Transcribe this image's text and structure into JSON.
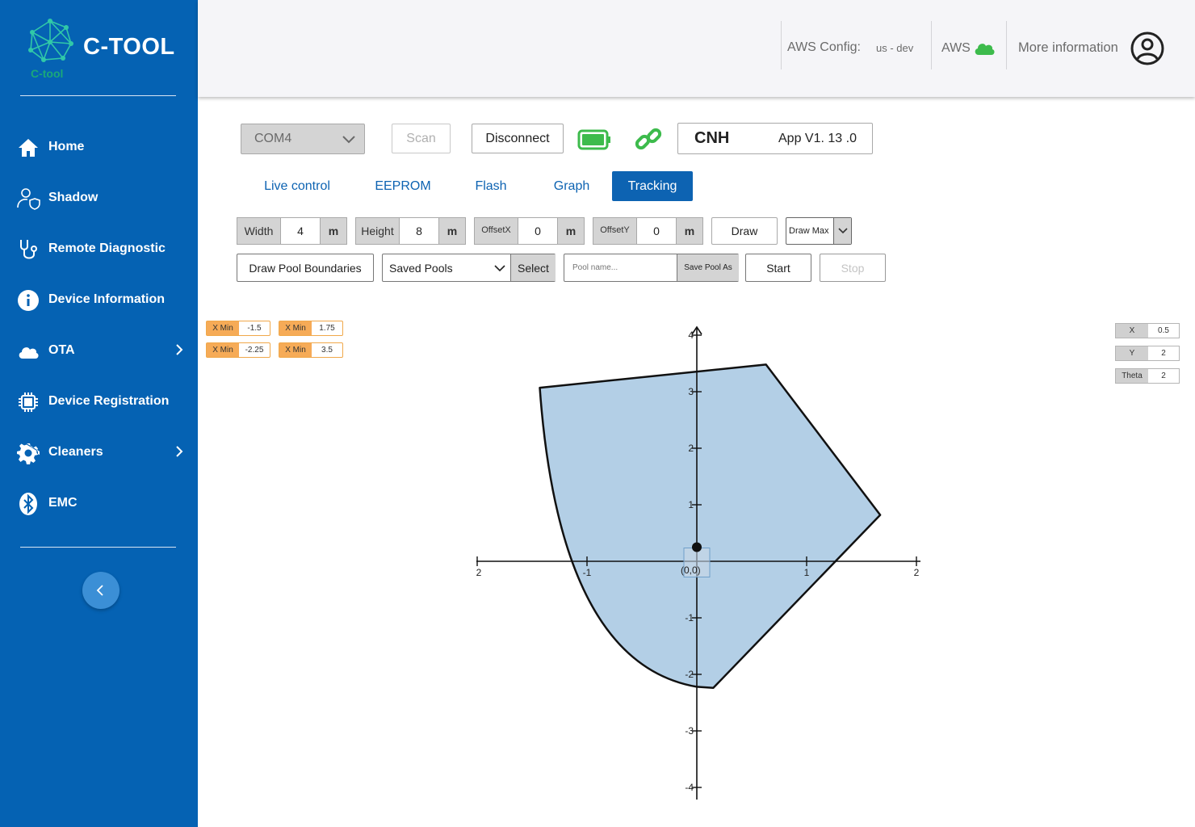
{
  "app": {
    "brand": "C-TOOL",
    "logo_text": "C-tool"
  },
  "sidebar": {
    "items": [
      {
        "label": "Home",
        "icon": "home-icon"
      },
      {
        "label": "Shadow",
        "icon": "user-shield-icon"
      },
      {
        "label": "Remote Diagnostic",
        "icon": "stethoscope-icon"
      },
      {
        "label": "Device Information",
        "icon": "info-icon"
      },
      {
        "label": "OTA",
        "icon": "cloud-icon",
        "has_submenu": true
      },
      {
        "label": "Device Registration",
        "icon": "chip-icon"
      },
      {
        "label": "Cleaners",
        "icon": "gear-icon",
        "has_submenu": true
      },
      {
        "label": "EMC",
        "icon": "bluetooth-icon"
      }
    ]
  },
  "header": {
    "aws_config_label": "AWS Config:",
    "aws_config_value": "us - dev",
    "aws_label": "AWS",
    "more_info": "More information"
  },
  "toolbar": {
    "port_value": "COM4",
    "scan_label": "Scan",
    "disconnect_label": "Disconnect",
    "brand": "CNH",
    "app_version": "App V1. 13 .0"
  },
  "tabs": [
    {
      "label": "Live control",
      "active": false
    },
    {
      "label": "EEPROM",
      "active": false
    },
    {
      "label": "Flash",
      "active": false
    },
    {
      "label": "Graph",
      "active": false
    },
    {
      "label": "Tracking",
      "active": true
    }
  ],
  "params": {
    "width": {
      "label": "Width",
      "value": "4",
      "unit": "m"
    },
    "height": {
      "label": "Height",
      "value": "8",
      "unit": "m"
    },
    "offset_x": {
      "label": "OffsetX",
      "value": "0",
      "unit": "m"
    },
    "offset_y": {
      "label": "OffsetY",
      "value": "0",
      "unit": "m"
    },
    "draw_label": "Draw",
    "draw_mode": "Draw Max"
  },
  "pool": {
    "draw_boundaries_label": "Draw Pool Boundaries",
    "saved_pools_value": "Saved Pools",
    "select_label": "Select",
    "name_placeholder": "Pool name...",
    "save_as_label": "Save Pool As",
    "start_label": "Start",
    "stop_label": "Stop"
  },
  "limits": [
    {
      "label": "X Min",
      "value": "-1.5"
    },
    {
      "label": "X Min",
      "value": "1.75"
    },
    {
      "label": "X Min",
      "value": "-2.25"
    },
    {
      "label": "X Min",
      "value": "3.5"
    }
  ],
  "readouts": [
    {
      "label": "X",
      "value": "0.5"
    },
    {
      "label": "Y",
      "value": "2"
    },
    {
      "label": "Theta",
      "value": "2"
    }
  ],
  "colors": {
    "sidebar": "#0562b3",
    "accent": "#0d63b2",
    "pool_fill": "#b3cfe6",
    "tag_orange": "#f6ab57",
    "battery_green": "#3dbb4c"
  },
  "chart_data": {
    "type": "area",
    "xlim": [
      -2,
      2
    ],
    "ylim": [
      -4,
      4
    ],
    "x_ticks": [
      "-2",
      "-1",
      "1",
      "2"
    ],
    "y_ticks": [
      "4",
      "3",
      "2",
      "1",
      "-1",
      "-2",
      "-3",
      "-4"
    ],
    "origin_label": "(0,0)",
    "pool_polygon": [
      [
        -1.43,
        3.07
      ],
      [
        0.63,
        3.48
      ],
      [
        1.67,
        0.82
      ],
      [
        0.15,
        -2.24
      ],
      [
        0.0,
        -2.22
      ]
    ],
    "robot_position": [
      0,
      0.25
    ]
  }
}
